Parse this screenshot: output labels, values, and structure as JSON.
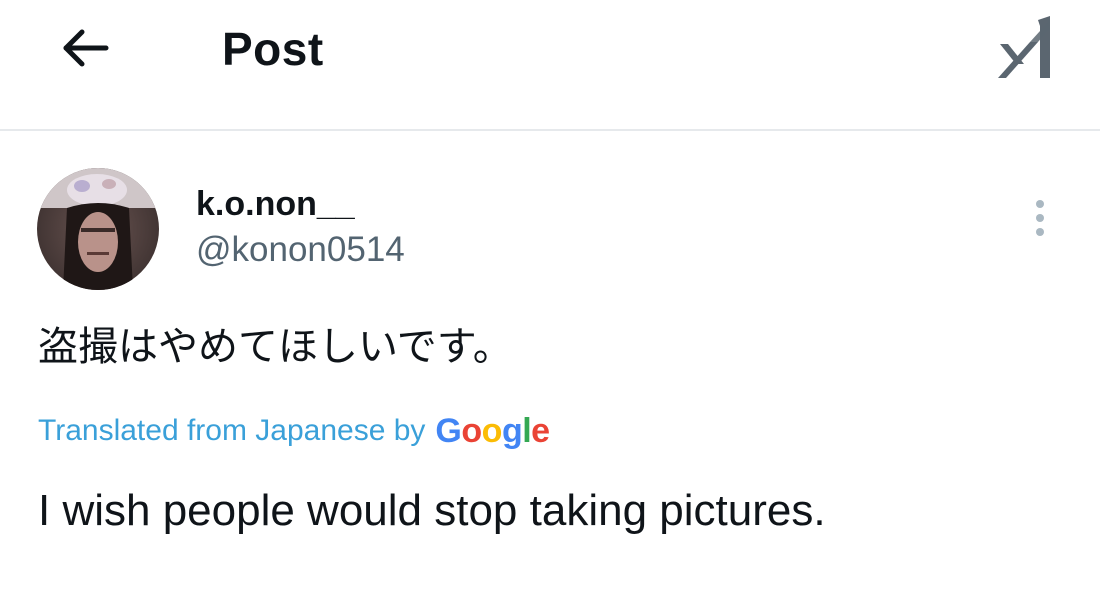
{
  "header": {
    "back_icon": "arrow-left-icon",
    "title": "Post",
    "grok_icon": "grok-logo-icon"
  },
  "post": {
    "author": {
      "display_name": "k.o.non__",
      "handle": "@konon0514",
      "avatar_icon": "profile-photo"
    },
    "more_icon": "more-vertical-icon",
    "text_original": "盗撮はやめてほしいです。",
    "translation": {
      "label": "Translated from Japanese by",
      "provider": [
        "G",
        "o",
        "o",
        "g",
        "l",
        "e"
      ],
      "provider_colors": [
        "#4285F4",
        "#EA4335",
        "#FBBC05",
        "#4285F4",
        "#34A853",
        "#EA4335"
      ],
      "label_color": "#3aa0d9"
    },
    "text_translated": "I wish people would stop taking pictures."
  }
}
